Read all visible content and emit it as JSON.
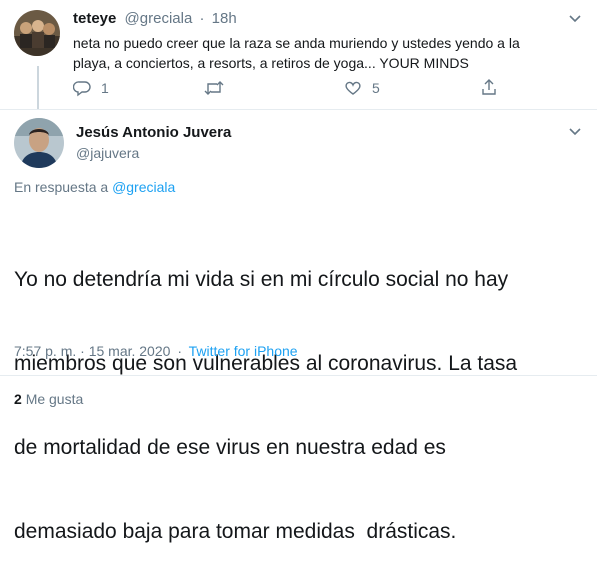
{
  "parent_tweet": {
    "display_name": "teteye",
    "handle": "@greciala",
    "separator": "·",
    "time": "18h",
    "text_line1": "neta no puedo creer que la raza se anda muriendo y ustedes yendo a la",
    "text_line2": "playa, a conciertos, a resorts, a retiros de yoga... YOUR MINDS",
    "reply_count": "1",
    "like_count": "5"
  },
  "main_tweet": {
    "display_name": "Jesús Antonio Juvera",
    "handle": "@jajuvera",
    "reply_prefix": "En respuesta a",
    "reply_to": "@greciala",
    "text_lines": [
      "Yo no detendría mi vida si en mi círculo social no hay",
      "miembros que son vulnerables al coronavirus. La tasa",
      "de mortalidad de ese virus en nuestra edad es",
      "demasiado baja para tomar medidas  drásticas."
    ],
    "timestamp": "7:57 p. m. · 15 mar. 2020",
    "meta_separator": "·",
    "source": "Twitter for iPhone",
    "likes_count": "2",
    "likes_label": "Me gusta"
  },
  "colors": {
    "link": "#1da1f2",
    "muted": "#657786",
    "text": "#14171a",
    "divider": "#e6ecf0"
  }
}
